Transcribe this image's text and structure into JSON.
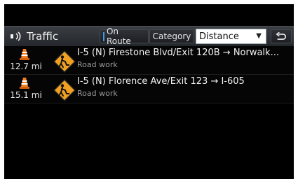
{
  "header": {
    "title": "Traffic",
    "title_icon": "traffic-radio-icon",
    "on_route_label": "On Route",
    "category_label": "Category",
    "sort_selected": "Distance",
    "back_icon": "back-arrow-icon"
  },
  "incidents": [
    {
      "distance": "12.7 mi",
      "description": "I-5 (N) Firestone Blvd/Exit 120B → Norwalk...",
      "type": "Road work",
      "icon": "road-work-icon"
    },
    {
      "distance": "15.1 mi",
      "description": "I-5 (N) Florence Ave/Exit 123 → I-605",
      "type": "Road work",
      "icon": "road-work-icon"
    }
  ],
  "colors": {
    "accent": "#3a9be8",
    "warning_sign": "#f0a020",
    "cone": "#f08020"
  }
}
